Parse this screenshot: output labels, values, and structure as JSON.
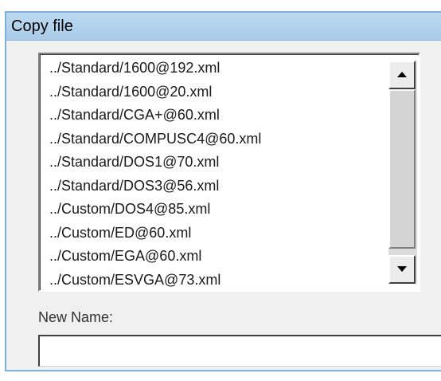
{
  "dialog": {
    "title": "Copy file"
  },
  "file_list": {
    "items": [
      "../Standard/1600@192.xml",
      "../Standard/1600@20.xml",
      "../Standard/CGA+@60.xml",
      "../Standard/COMPUSC4@60.xml",
      "../Standard/DOS1@70.xml",
      "../Standard/DOS3@56.xml",
      "../Custom/DOS4@85.xml",
      "../Custom/ED@60.xml",
      "../Custom/EGA@60.xml",
      "../Custom/ESVGA@73.xml"
    ],
    "scrollbar": {
      "up_icon": "arrow-up-icon",
      "down_icon": "arrow-down-icon"
    }
  },
  "new_name": {
    "label": "New Name:",
    "value": ""
  },
  "colors": {
    "title_bar": "#a9cbe8",
    "frame_border": "#7fb2dc",
    "dialog_background": "#f0f0f0"
  }
}
